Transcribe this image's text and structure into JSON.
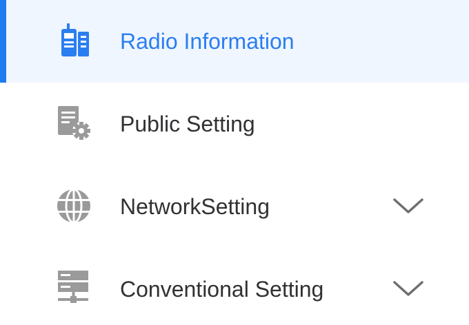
{
  "colors": {
    "accent": "#2a7ef0",
    "accent_bar": "#1e7bf0",
    "active_bg": "#f0f6ff",
    "text": "#303133",
    "icon_gray": "#9a9a9a",
    "chevron": "#6e6e6e"
  },
  "menu": {
    "items": [
      {
        "label": "Radio Information",
        "icon": "radio-icon",
        "active": true,
        "expandable": false
      },
      {
        "label": "Public Setting",
        "icon": "settings-document-icon",
        "active": false,
        "expandable": false
      },
      {
        "label": "NetworkSetting",
        "icon": "globe-icon",
        "active": false,
        "expandable": true
      },
      {
        "label": "Conventional Setting",
        "icon": "server-icon",
        "active": false,
        "expandable": true
      }
    ]
  }
}
